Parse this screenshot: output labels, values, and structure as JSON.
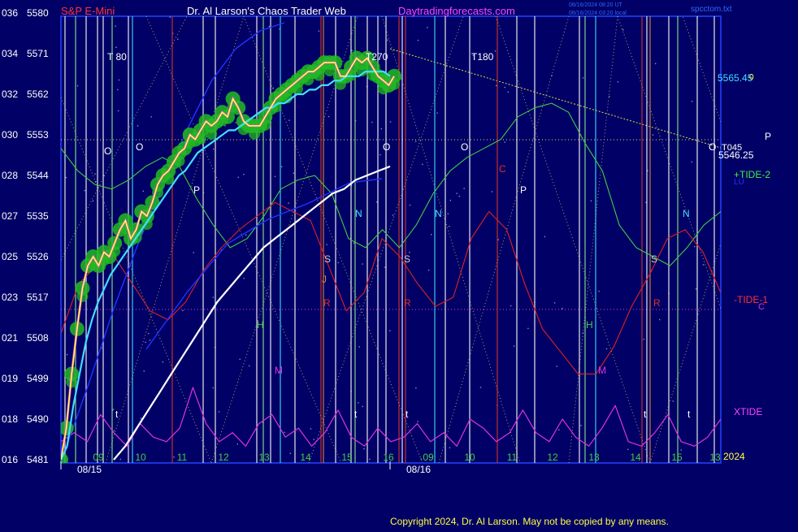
{
  "header": {
    "symbol": "S&P E-Mini",
    "title": "Dr. Al Larson's Chaos Trader Web",
    "site": "Daytradingforecasts.com",
    "timestamp_1": "08/16/2024 08:20 UT",
    "timestamp_2": "08/16/2024 03:20 local",
    "file": "spcctom.txt"
  },
  "footer": {
    "copyright": "Copyright 2024, Dr. Al Larson. May not be copied by any means."
  },
  "colors": {
    "background": "#000066",
    "price": "#ffff44",
    "ma_fast": "#44ddff",
    "ma_slow": "#ffffff",
    "ma_blue": "#2233ff",
    "tide_plus": "#44cc44",
    "tide_minus": "#dd2222",
    "xtide": "#dd33dd",
    "glow": "#22bb22",
    "grid_dots": "#bbbb66"
  },
  "chart_data": {
    "type": "line",
    "title": "S&P E-Mini",
    "y_left_codes": [
      "036",
      "034",
      "032",
      "030",
      "028",
      "027",
      "025",
      "023",
      "021",
      "019",
      "018",
      "016"
    ],
    "y_ticks": [
      5580,
      5571,
      5562,
      5553,
      5544,
      5535,
      5526,
      5517,
      5508,
      5499,
      5490,
      5481
    ],
    "ylim": [
      5481,
      5580
    ],
    "x_ticks": [
      "09",
      "10",
      "11",
      "12",
      "13",
      "14",
      "15",
      "16",
      "09",
      "10",
      "11",
      "12",
      "13",
      "14",
      "15",
      "13"
    ],
    "x_day_labels": [
      "08/15",
      "08/16"
    ],
    "year_label": "2024",
    "price_labels": {
      "upper": "5565.45",
      "upper_suffix": "0",
      "lower": "5546.25"
    },
    "right_labels": {
      "tide_plus": "+TIDE-2",
      "tide_minus": "-TIDE-1",
      "xtide": "XTIDE",
      "lu": "LU",
      "c_marker": "C",
      "t045": "T045",
      "p_marker": "P",
      "o_marker": "O"
    },
    "markers": {
      "t_labels": [
        "T 80",
        "T270",
        "T180"
      ],
      "letters": [
        "O",
        "P",
        "N",
        "S",
        "R",
        "H",
        "M",
        "J",
        "C",
        "t",
        "t",
        "t",
        "t",
        "t",
        "O",
        "O",
        "O",
        "P",
        "N",
        "S",
        "R",
        "H",
        "M",
        "N",
        "S",
        "R"
      ]
    },
    "series": [
      {
        "name": "Price",
        "values": [
          5481,
          5488,
          5500,
          5510,
          5519,
          5524,
          5526,
          5524,
          5527,
          5526,
          5529,
          5532,
          5534,
          5530,
          5532,
          5536,
          5535,
          5538,
          5542,
          5544,
          5545,
          5547,
          5549,
          5550,
          5553,
          5552,
          5554,
          5556,
          5555,
          5556,
          5558,
          5557,
          5561,
          5559,
          5556,
          5555,
          5555,
          5555,
          5557,
          5559,
          5561,
          5562,
          5563,
          5564,
          5565,
          5566,
          5567,
          5567,
          5568,
          5569,
          5569,
          5569,
          5566,
          5566,
          5568,
          5570,
          5569,
          5570,
          5568,
          5566,
          5565,
          5564,
          5566
        ]
      },
      {
        "name": "MA fast",
        "values": [
          5481,
          5484,
          5493,
          5500,
          5507,
          5512,
          5516,
          5519,
          5522,
          5524,
          5526,
          5528,
          5530,
          5532,
          5534,
          5536,
          5538,
          5540,
          5542,
          5544,
          5545,
          5547,
          5549,
          5550,
          5551,
          5552,
          5553,
          5554,
          5554,
          5555,
          5556,
          5557,
          5558,
          5559,
          5559,
          5560,
          5560,
          5561,
          5562,
          5562,
          5563,
          5563,
          5564,
          5564,
          5565,
          5565,
          5566,
          5566,
          5566,
          5567,
          5567,
          5567,
          5567,
          5566
        ]
      },
      {
        "name": "MA slow",
        "values": [
          5481,
          5484,
          5488,
          5492,
          5496,
          5500,
          5504,
          5508,
          5512,
          5516,
          5519,
          5522,
          5525,
          5528,
          5530,
          5532,
          5534,
          5536,
          5538,
          5540,
          5541,
          5543,
          5544,
          5545,
          5546
        ]
      },
      {
        "name": "TIDE-2",
        "values": [
          5550,
          5545,
          5542,
          5541,
          5543,
          5546,
          5548,
          5546,
          5539,
          5533,
          5528,
          5530,
          5535,
          5541,
          5543,
          5544,
          5540,
          5530,
          5528,
          5532,
          5528,
          5533,
          5540,
          5545,
          5548,
          5550,
          5552,
          5557,
          5559,
          5560,
          5558,
          5551,
          5545,
          5533,
          5528,
          5526,
          5524,
          5528,
          5533,
          5536
        ]
      },
      {
        "name": "TIDE-1",
        "values": [
          5509,
          5520,
          5524,
          5526,
          5520,
          5514,
          5512,
          5516,
          5523,
          5528,
          5532,
          5535,
          5538,
          5536,
          5534,
          5524,
          5514,
          5518,
          5530,
          5526,
          5520,
          5515,
          5517,
          5530,
          5536,
          5532,
          5520,
          5510,
          5505,
          5500,
          5500,
          5506,
          5515,
          5522,
          5530,
          5532,
          5527,
          5518
        ]
      },
      {
        "name": "XTIDE",
        "values": [
          5485,
          5487,
          5485,
          5491,
          5487,
          5484,
          5489,
          5486,
          5485,
          5488,
          5497,
          5489,
          5485,
          5487,
          5484,
          5489,
          5491,
          5486,
          5488,
          5484,
          5487,
          5492,
          5486,
          5484,
          5488,
          5485,
          5486,
          5489,
          5485,
          5487,
          5484,
          5490,
          5488,
          5485,
          5487,
          5492,
          5487,
          5485,
          5490,
          5486,
          5484,
          5488,
          5493,
          5485,
          5484,
          5487,
          5491,
          5485,
          5484,
          5486,
          5490
        ]
      }
    ]
  }
}
